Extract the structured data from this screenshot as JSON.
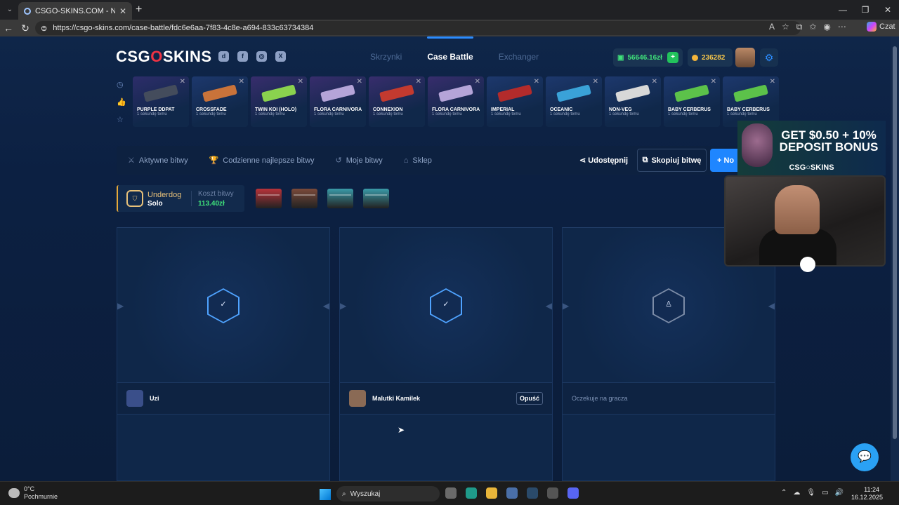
{
  "browser": {
    "tab_title": "CSGO-SKINS.COM - Najlepsze Sk",
    "url": "https://csgo-skins.com/case-battle/fdc6e6aa-7f83-4c8e-a694-833c63734384",
    "copilot_label": "Czat"
  },
  "header": {
    "logo_left": "CSG",
    "logo_o": "O",
    "logo_right": "SKINS",
    "nav": [
      "Skrzynki",
      "Case Battle",
      "Exchanger"
    ],
    "balance": "56646.16zł",
    "coins": "236282"
  },
  "live_drops": [
    {
      "name": "PURPLE DDPAT",
      "time": "1 sekundę temu",
      "color": "#6a3fb0",
      "item_color": "#444c5c"
    },
    {
      "name": "CROSSFADE",
      "time": "1 sekundę temu",
      "color": "#3a5fb8",
      "item_color": "#c9733a"
    },
    {
      "name": "TWIN KOI (HOLO)",
      "time": "1 sekundę temu",
      "color": "#8a3fb8",
      "item_color": "#8ad24e"
    },
    {
      "name": "FLORA CARNIVORA",
      "time": "1 sekundę temu",
      "color": "#8a3fb8",
      "item_color": "#b5a4d8"
    },
    {
      "name": "CONNEXION",
      "time": "1 sekundę temu",
      "color": "#8a3fb8",
      "item_color": "#c33a2f"
    },
    {
      "name": "FLORA CARNIVORA",
      "time": "1 sekundę temu",
      "color": "#8a3fb8",
      "item_color": "#b5a4d8"
    },
    {
      "name": "IMPERIAL",
      "time": "1 sekundę temu",
      "color": "#3a5fb8",
      "item_color": "#b32b2b"
    },
    {
      "name": "OCEANIC",
      "time": "1 sekundę temu",
      "color": "#3a5fb8",
      "item_color": "#3aa2d8"
    },
    {
      "name": "NON-VEG",
      "time": "1 sekundę temu",
      "color": "#3a5fb8",
      "item_color": "#d8d8d8"
    },
    {
      "name": "BABY CERBERUS",
      "time": "1 sekundę temu",
      "color": "#3a5fb8",
      "item_color": "#5cc24a"
    },
    {
      "name": "BABY CERBERUS",
      "time": "1 sekundę temu",
      "color": "#3a5fb8",
      "item_color": "#5cc24a"
    }
  ],
  "battle_bar": {
    "tabs": [
      "Aktywne bitwy",
      "Codzienne najlepsze bitwy",
      "Moje bitwy",
      "Sklep"
    ],
    "share": "Udostępnij",
    "copy": "Skopiuj bitwę",
    "new": "+ No"
  },
  "mode": {
    "name": "Underdog",
    "type": "Solo",
    "cost_label": "Koszt bitwy",
    "cost": "113.40zł"
  },
  "cases": [
    {
      "color": "#b8333a"
    },
    {
      "color": "#7a4a3a"
    },
    {
      "color": "#3a9aa8"
    },
    {
      "color": "#3a9aa8"
    }
  ],
  "slots": [
    {
      "icon": "✓",
      "player": "Uzi",
      "avatar": "#3a4f8a"
    },
    {
      "icon": "✓",
      "player": "Malutki Kamilek",
      "avatar": "#8a6a55",
      "leave": "Opuść"
    },
    {
      "icon": "♙",
      "waiting": "Oczekuje na gracza"
    }
  ],
  "promo": {
    "text": "GET $0.50 + 10% DEPOSIT BONUS",
    "brand": "CSG○SKINS"
  },
  "taskbar": {
    "temp": "0°C",
    "weather": "Pochmurnie",
    "search": "Wyszukaj",
    "time": "11:24",
    "date": "16.12.2025"
  }
}
